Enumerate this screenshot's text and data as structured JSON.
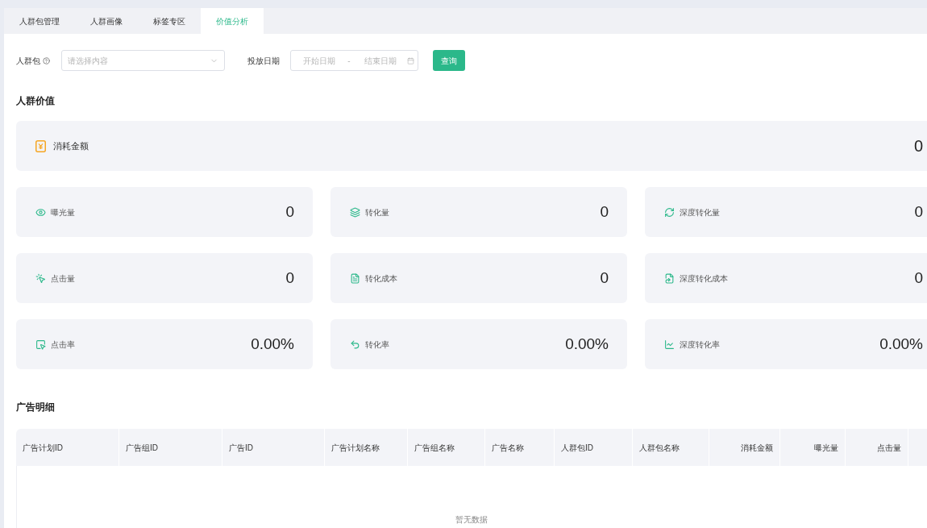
{
  "tabs": [
    {
      "label": "人群包管理",
      "selected": false
    },
    {
      "label": "人群画像",
      "selected": false
    },
    {
      "label": "标签专区",
      "selected": false
    },
    {
      "label": "价值分析",
      "selected": true
    }
  ],
  "filters": {
    "crowd_pack": {
      "label": "人群包",
      "placeholder": "请选择内容"
    },
    "delivery_date": {
      "label": "投放日期",
      "start_placeholder": "开始日期",
      "separator": "-",
      "end_placeholder": "结束日期"
    },
    "query_button": "查询"
  },
  "crowd_value": {
    "title": "人群价值",
    "total": {
      "label": "消耗金额",
      "value": "0"
    },
    "metrics": [
      {
        "label": "曝光量",
        "value": "0"
      },
      {
        "label": "转化量",
        "value": "0"
      },
      {
        "label": "深度转化量",
        "value": "0"
      },
      {
        "label": "点击量",
        "value": "0"
      },
      {
        "label": "转化成本",
        "value": "0"
      },
      {
        "label": "深度转化成本",
        "value": "0"
      },
      {
        "label": "点击率",
        "value": "0.00%"
      },
      {
        "label": "转化率",
        "value": "0.00%"
      },
      {
        "label": "深度转化率",
        "value": "0.00%"
      }
    ]
  },
  "ad_detail": {
    "title": "广告明细",
    "table": {
      "columns": [
        "广告计划ID",
        "广告组ID",
        "广告ID",
        "广告计划名称",
        "广告组名称",
        "广告名称",
        "人群包ID",
        "人群包名称",
        "消耗金额",
        "曝光量",
        "点击量"
      ],
      "empty_text": "暂无数据"
    }
  }
}
